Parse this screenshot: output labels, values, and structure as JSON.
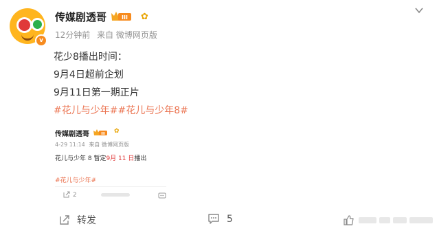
{
  "post": {
    "author": "传媒剧透哥",
    "vip_level": "III",
    "time": "12分钟前",
    "source": "来自 微博网页版",
    "content_lines": [
      "花少8播出时间：",
      "9月4日超前企划",
      "9月11日第一期正片"
    ],
    "topic": "#花儿与少年##花儿与少年8#"
  },
  "repost": {
    "author": "传媒剧透哥",
    "vip_level": "III",
    "time": "4-29 11:14",
    "source": "来自 微博网页版",
    "text_before": "花儿与少年 8 暂定",
    "text_highlight": "9月 11 日",
    "text_after": "播出",
    "topic": "#花儿与少年#",
    "share_count": "2"
  },
  "footer": {
    "share_label": "转发",
    "comment_count": "5"
  },
  "colors": {
    "topic": "#eb7350",
    "highlight": "#e03a3a",
    "muted": "#939393"
  },
  "icons": [
    "more-chevron-icon",
    "share-icon",
    "comment-icon",
    "like-icon",
    "sunflower-icon",
    "vip-crown-icon"
  ]
}
